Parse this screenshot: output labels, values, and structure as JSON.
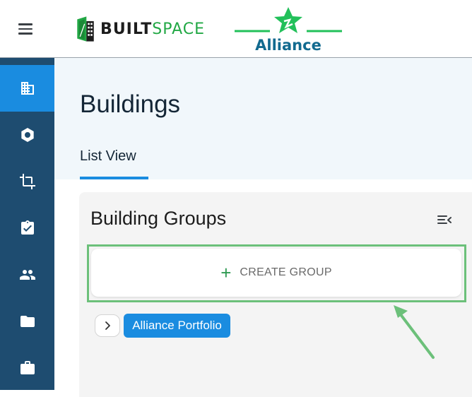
{
  "header": {
    "menu_icon": "hamburger-menu-icon",
    "brand": {
      "part1": "BUILT",
      "part2": "SPACE"
    },
    "partner": {
      "name": "Alliance"
    }
  },
  "sidebar": {
    "items": [
      {
        "icon": "buildings-icon",
        "active": true
      },
      {
        "icon": "hexagon-icon",
        "active": false
      },
      {
        "icon": "crop-icon",
        "active": false
      },
      {
        "icon": "clipboard-check-icon",
        "active": false
      },
      {
        "icon": "people-icon",
        "active": false
      },
      {
        "icon": "folder-icon",
        "active": false
      },
      {
        "icon": "briefcase-icon",
        "active": false
      }
    ]
  },
  "page": {
    "title": "Buildings",
    "tabs": [
      {
        "label": "List View",
        "active": true
      }
    ]
  },
  "groups_panel": {
    "title": "Building Groups",
    "create_button": {
      "icon": "plus",
      "label": "CREATE GROUP"
    },
    "groups": [
      {
        "name": "Alliance Portfolio"
      }
    ]
  },
  "colors": {
    "sidebar_bg": "#1e4c70",
    "accent_blue": "#1a8ce0",
    "highlight_green": "#6cc07a",
    "brand_green": "#22a845",
    "alliance_teal": "#126a8f"
  }
}
